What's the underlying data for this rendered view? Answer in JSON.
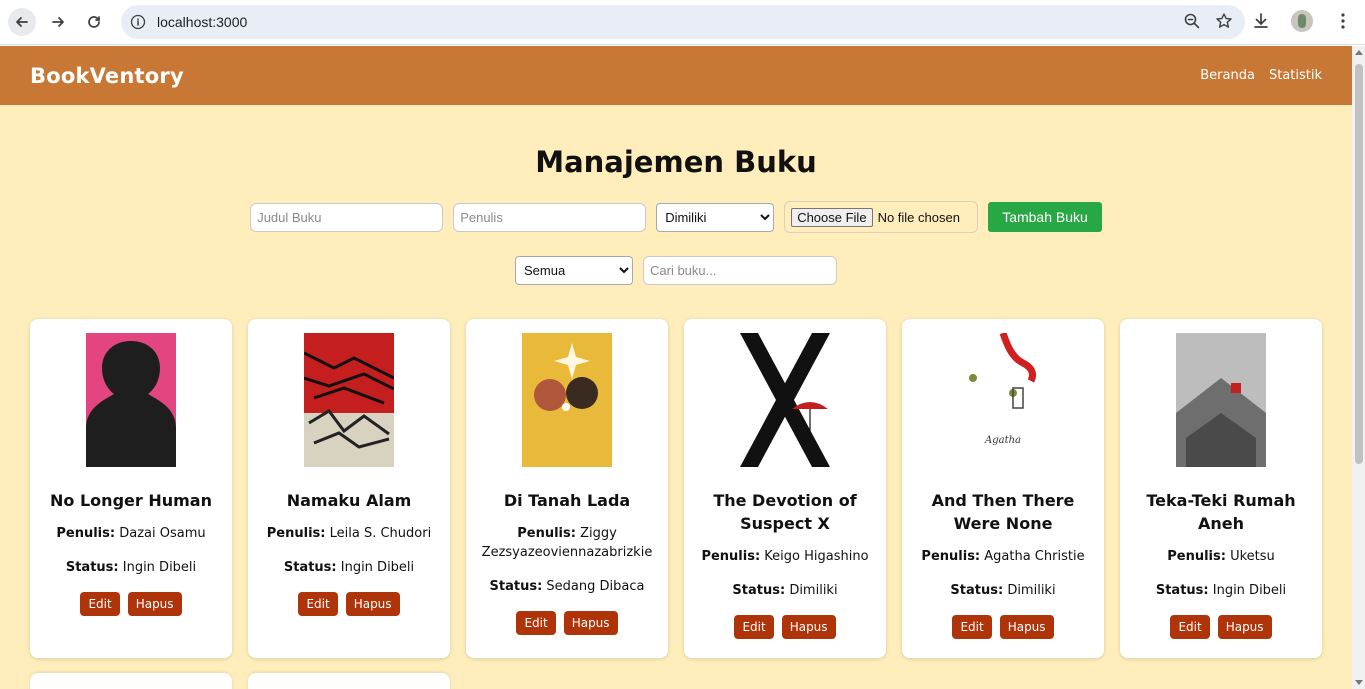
{
  "browser": {
    "url": "localhost:3000"
  },
  "header": {
    "brand": "BookVentory",
    "nav": [
      "Beranda",
      "Statistik"
    ]
  },
  "page_title": "Manajemen Buku",
  "form": {
    "title_placeholder": "Judul Buku",
    "author_placeholder": "Penulis",
    "status_selected": "Dimiliki",
    "file_button": "Choose File",
    "file_text": "No file chosen",
    "submit_label": "Tambah Buku"
  },
  "filter": {
    "status_selected": "Semua",
    "search_placeholder": "Cari buku..."
  },
  "labels": {
    "author": "Penulis:",
    "status": "Status:",
    "edit": "Edit",
    "delete": "Hapus"
  },
  "books": [
    {
      "title": "No Longer Human",
      "author": "Dazai Osamu",
      "status": "Ingin Dibeli",
      "cover_color": "#e2457f"
    },
    {
      "title": "Namaku Alam",
      "author": "Leila S. Chudori",
      "status": "Ingin Dibeli",
      "cover_color": "#c41e1e"
    },
    {
      "title": "Di Tanah Lada",
      "author": "Ziggy Zezsyazeoviennazabrizkie",
      "status": "Sedang Dibaca",
      "cover_color": "#e9b93a"
    },
    {
      "title": "The Devotion of Suspect X",
      "author": "Keigo Higashino",
      "status": "Dimiliki",
      "cover_color": "#ffffff"
    },
    {
      "title": "And Then There Were None",
      "author": "Agatha Christie",
      "status": "Dimiliki",
      "cover_color": "#ffffff"
    },
    {
      "title": "Teka-Teki Rumah Aneh",
      "author": "Uketsu",
      "status": "Ingin Dibeli",
      "cover_color": "#bdbdbd"
    }
  ],
  "colors": {
    "header": "#c97735",
    "background": "#ffeebb",
    "add_button": "#28a745",
    "action_button": "#b0340a"
  }
}
